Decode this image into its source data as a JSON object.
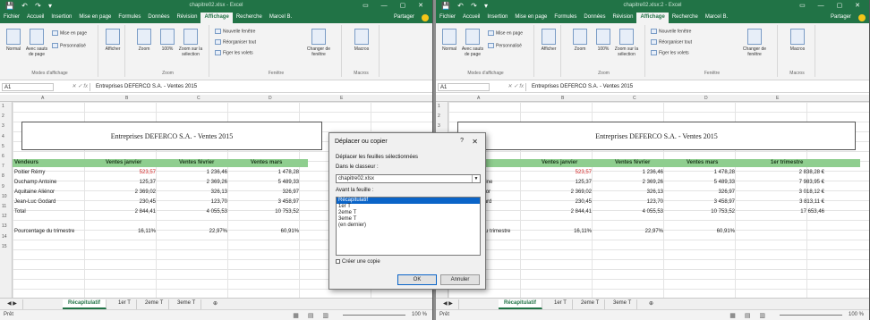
{
  "windows": [
    {
      "id": "w1",
      "title": "chapitre02.xlsx - Excel",
      "tabs": [
        "Fichier",
        "Accueil",
        "Insertion",
        "Mise en page",
        "Formules",
        "Données",
        "Révision",
        "Affichage",
        "Recherche",
        "Marcel B.",
        "Partager"
      ],
      "active_tab": "Affichage",
      "ribbon": {
        "normal": "Normal",
        "page_break": "Avec sauts de page",
        "page_layout": "Mise en page",
        "custom": "Personnalisé",
        "group_views": "Modes d'affichage",
        "show": "Afficher",
        "zoom": "Zoom",
        "zoom100": "100%",
        "zoom_sel": "Zoom sur la sélection",
        "group_zoom": "Zoom",
        "new_window": "Nouvelle fenêtre",
        "arrange_all": "Réorganiser tout",
        "freeze": "Figer les volets",
        "switch": "Changer de fenêtre",
        "macros": "Macros",
        "group_window": "Fenêtre",
        "group_macros": "Macros"
      },
      "namebox": "A1",
      "formula": "Entreprises DEFERCO S.A. - Ventes 2015",
      "cols": [
        "A",
        "B",
        "C",
        "D",
        "E"
      ],
      "rows": [
        "1",
        "2",
        "3",
        "4",
        "5",
        "6",
        "7",
        "8",
        "9",
        "10",
        "11",
        "12",
        "13",
        "14",
        "15"
      ],
      "sheet_title": "Entreprises DEFERCO S.A. - Ventes 2015",
      "headers": [
        "Vendeurs",
        "Ventes janvier",
        "Ventes février",
        "Ventes mars"
      ],
      "data": [
        [
          "Poitier Rémy",
          "523,57",
          "1 236,46",
          "1 478,28"
        ],
        [
          "Duchamp Antoine",
          "125,37",
          "2 369,26",
          "5 489,33"
        ],
        [
          "Aquitaine Aliénor",
          "2 369,02",
          "326,13",
          "326,97"
        ],
        [
          "Jean-Luc Godard",
          "230,45",
          "123,70",
          "3 458,97"
        ],
        [
          "Total",
          "2 844,41",
          "4 055,53",
          "10 753,52"
        ]
      ],
      "pct_label": "Pourcentage du trimestre",
      "pct": [
        "16,11%",
        "22,97%",
        "60,91%"
      ],
      "sheet_tabs": [
        "Récapitulatif",
        "1er T",
        "2eme T",
        "3eme T"
      ],
      "status": "Prêt",
      "zoom": "100 %"
    },
    {
      "id": "w2",
      "title": "chapitre02.xlsx:2 - Excel",
      "tabs": [
        "Fichier",
        "Accueil",
        "Insertion",
        "Mise en page",
        "Formules",
        "Données",
        "Révision",
        "Affichage",
        "Recherche",
        "Marcel B.",
        "Partager"
      ],
      "active_tab": "Affichage",
      "ribbon": {
        "normal": "Normal",
        "page_break": "Avec sauts de page",
        "page_layout": "Mise en page",
        "custom": "Personnalisé",
        "group_views": "Modes d'affichage",
        "show": "Afficher",
        "zoom": "Zoom",
        "zoom100": "100%",
        "zoom_sel": "Zoom sur la sélection",
        "group_zoom": "Zoom",
        "new_window": "Nouvelle fenêtre",
        "arrange_all": "Réorganiser tout",
        "freeze": "Figer les volets",
        "switch": "Changer de fenêtre",
        "macros": "Macros",
        "group_window": "Fenêtre",
        "group_macros": "Macros"
      },
      "namebox": "A1",
      "formula": "Entreprises DEFERCO S.A. - Ventes 2015",
      "cols": [
        "A",
        "B",
        "C",
        "D",
        "E"
      ],
      "rows": [
        "1",
        "2",
        "3",
        "4",
        "5",
        "6",
        "7",
        "8",
        "9",
        "10",
        "11",
        "12",
        "13",
        "14",
        "15"
      ],
      "sheet_title": "Entreprises DEFERCO S.A. - Ventes 2015",
      "headers": [
        "Vendeurs",
        "Ventes janvier",
        "Ventes février",
        "Ventes mars",
        "1er trimestre"
      ],
      "data": [
        [
          "Poitier Rémy",
          "523,57",
          "1 236,46",
          "1 478,28",
          "2 838,28 €"
        ],
        [
          "Duchamp Antoine",
          "125,37",
          "2 369,26",
          "5 489,33",
          "7 983,95 €"
        ],
        [
          "Aquitaine Aliénor",
          "2 369,02",
          "326,13",
          "326,97",
          "3 018,12 €"
        ],
        [
          "Jean-Luc Godard",
          "230,45",
          "123,70",
          "3 458,97",
          "3 813,11 €"
        ],
        [
          "Total",
          "2 844,41",
          "4 055,53",
          "10 753,52",
          "17 653,46"
        ]
      ],
      "pct_label": "Pourcentage du trimestre",
      "pct": [
        "16,11%",
        "22,97%",
        "60,91%"
      ],
      "sheet_tabs": [
        "Récapitulatif",
        "1er T",
        "2eme T",
        "3eme T"
      ],
      "status": "Prêt",
      "zoom": "100 %"
    }
  ],
  "dialog": {
    "title": "Déplacer ou copier",
    "help": "?",
    "close": "✕",
    "move_label": "Déplacer les feuilles sélectionnées",
    "into_label": "Dans le classeur :",
    "workbook": "chapitre02.xlsx",
    "before_label": "Avant la feuille :",
    "list": [
      "Récapitulatif",
      "1er T",
      "2eme T",
      "3eme T",
      "(en dernier)"
    ],
    "selected_index": 0,
    "copy_label": "Créer une copie",
    "ok": "OK",
    "cancel": "Annuler"
  },
  "colors": {
    "excel_green": "#217346",
    "header_green": "#8fce8f",
    "selection_blue": "#0a64c8",
    "negative_red": "#d02020"
  }
}
